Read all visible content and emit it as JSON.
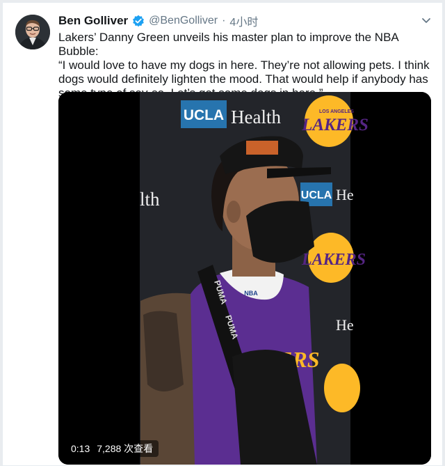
{
  "tweet": {
    "author_name": "Ben Golliver",
    "handle": "@BenGolliver",
    "separator": "·",
    "time": "4小时",
    "text_lines": [
      "Lakers’ Danny Green unveils his master plan to improve the NBA Bubble:",
      "“I would love to have my dogs in here. They’re not allowing pets. I think",
      "dogs would definitely lighten the mood. That would help if anybody has",
      "some type of say-so. Let’s get some dogs in here.”"
    ]
  },
  "video": {
    "elapsed": "0:13",
    "views": "7,288 次查看",
    "backdrop_logo_text": "UCLA",
    "backdrop_logo_word": "Health",
    "backdrop_partial_logo": "UCLA",
    "backdrop_partial_word": "He",
    "backdrop_left_word": "lth",
    "backdrop_team": "LAKERS",
    "backdrop_team_small": "LOS ANGELES",
    "jersey_text": "ERS",
    "strap_text": "PUMA",
    "collar_text": "NBA"
  },
  "colors": {
    "verified_blue": "#1da1f2",
    "ucla_blue": "#2774ae",
    "lakers_purple": "#552583",
    "lakers_gold": "#fdb927"
  },
  "icons": [
    "verified-badge-icon",
    "chevron-down-icon"
  ]
}
